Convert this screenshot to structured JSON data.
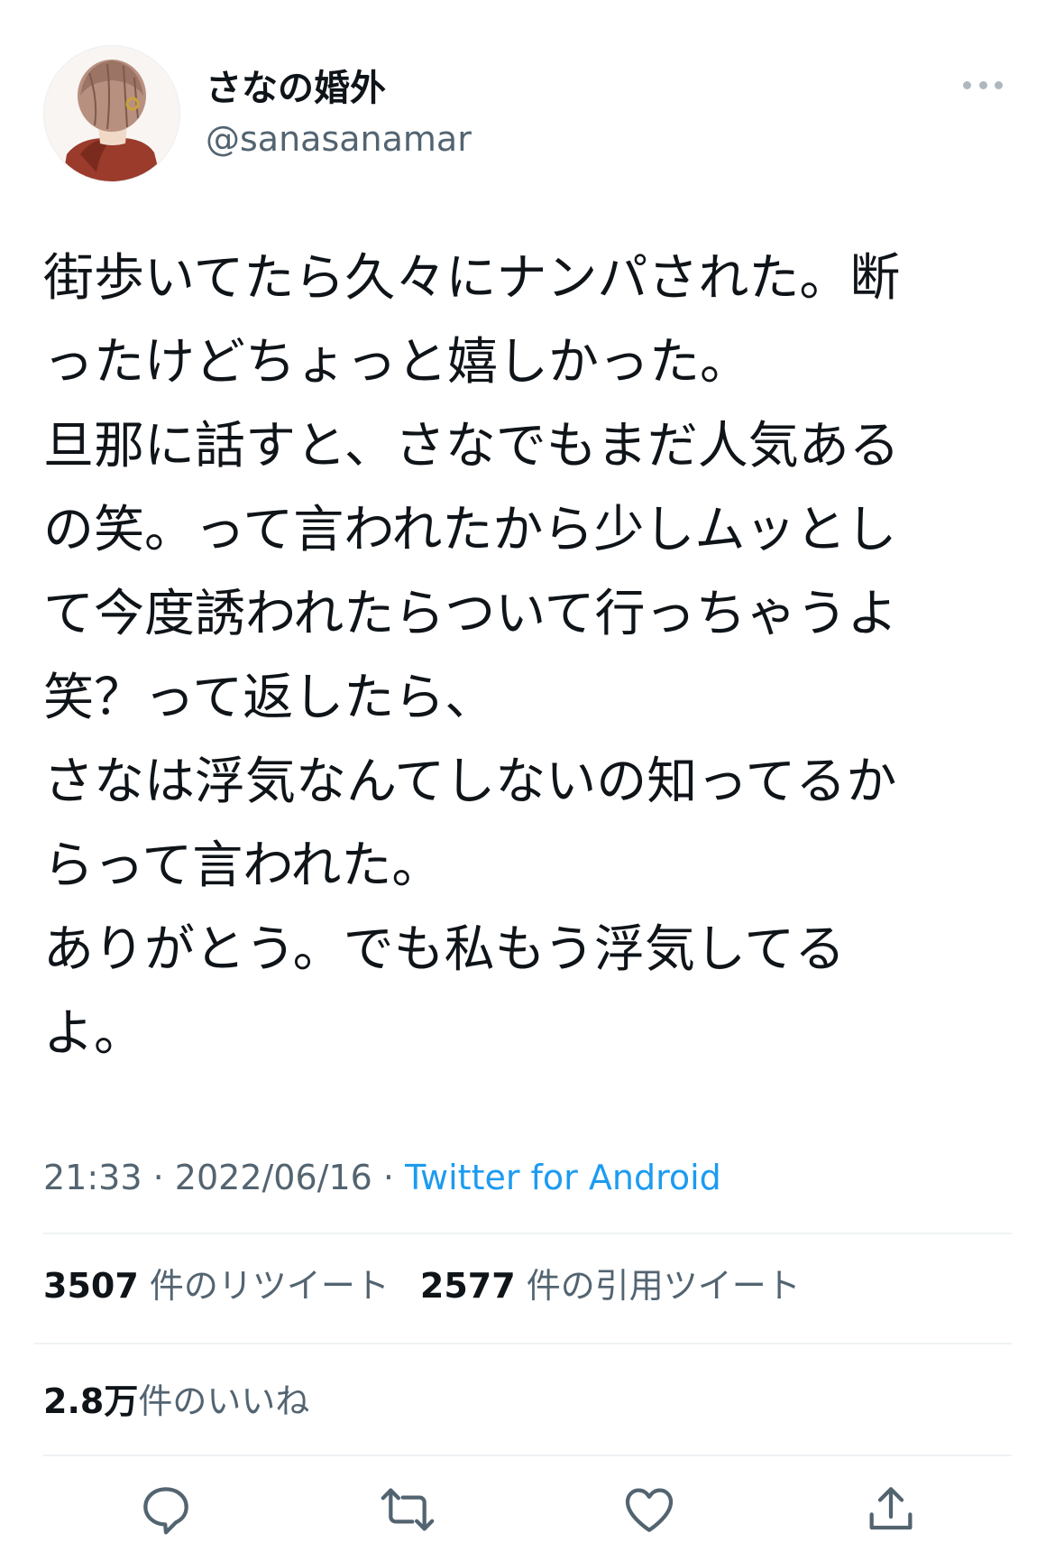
{
  "user": {
    "display_name": "さなの婚外",
    "handle": "@sanasanamar",
    "avatar_icon": "avatar-illustration-icon"
  },
  "tweet": {
    "text": "街歩いてたら久々にナンパされた。断\nったけどちょっと嬉しかった。\n旦那に話すと、さなでもまだ人気ある\nの笑。って言われたから少しムッとし\nて今度誘われたらついて行っちゃうよ\n笑？って返したら、\nさなは浮気なんてしないの知ってるか\nらって言われた。\nありがとう。でも私もう浮気してる\nよ。",
    "time": "21:33",
    "date": "2022/06/16",
    "separator": "·",
    "source": "Twitter for Android"
  },
  "stats": {
    "retweets_count": "3507",
    "retweets_label": "件のリツイート",
    "quotes_count": "2577",
    "quotes_label": "件の引用ツイート",
    "likes_count": "2.8万",
    "likes_label": "件のいいね"
  },
  "actions": [
    "reply-icon",
    "retweet-icon",
    "like-icon",
    "share-icon"
  ],
  "colors": {
    "text": "#0f1419",
    "secondary": "#536471",
    "link": "#1d9bf0",
    "divider": "#eff3f4"
  }
}
